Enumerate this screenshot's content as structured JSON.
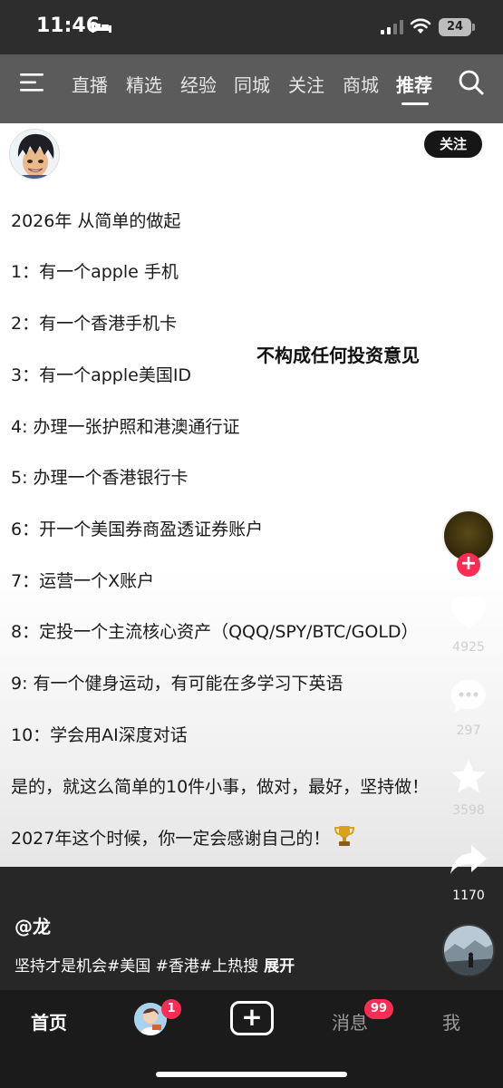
{
  "status_bar": {
    "time": "11:46",
    "battery": "24"
  },
  "top_nav": {
    "tabs": [
      {
        "label": "直播"
      },
      {
        "label": "精选"
      },
      {
        "label": "经验"
      },
      {
        "label": "同城"
      },
      {
        "label": "关注"
      },
      {
        "label": "商城"
      },
      {
        "label": "推荐",
        "active": true
      }
    ]
  },
  "post": {
    "follow_label": "关注",
    "lines": [
      "2026年 从简单的做起",
      "1：有一个apple 手机",
      "2：有一个香港手机卡",
      "3：有一个apple美国ID",
      "4: 办理一张护照和港澳通行证",
      "5: 办理一个香港银行卡",
      "6：开一个美国券商盈透证券账户",
      "7：运营一个X账户",
      "8：定投一个主流核心资产（QQQ/SPY/BTC/GOLD）",
      "9: 有一个健身运动，有可能在多学习下英语",
      "10：学会用AI深度对话",
      "是的，就这么简单的10件小事，做对，最好，坚持做！",
      "2027年这个时候，你一定会感谢自己的！"
    ],
    "disclaimer": "不构成任何投资意见"
  },
  "rail": {
    "likes": "4925",
    "comments": "297",
    "favorites": "3598",
    "shares": "1170"
  },
  "caption": {
    "username": "@龙",
    "text": "坚持才是机会#美国 #香港#上热搜",
    "expand": "展开"
  },
  "bottom_bar": {
    "home": "首页",
    "friends_badge": "1",
    "messages": "消息",
    "messages_badge": "99",
    "me": "我"
  },
  "colors": {
    "accent_red": "#fe2c55",
    "nav_bg": "#5b5b5b",
    "bottom_bg": "#1b1b1b"
  }
}
